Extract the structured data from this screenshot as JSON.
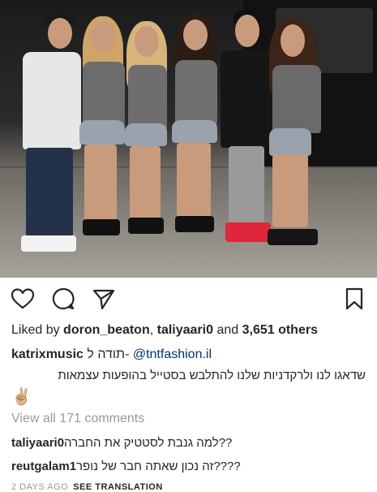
{
  "post": {
    "likes": {
      "prefix": "Liked by ",
      "user1": "doron_beaton",
      "separator": ", ",
      "user2": "taliyaari0",
      "middle": " and ",
      "count": "3,651 others"
    },
    "caption": {
      "username": "katrixmusic",
      "text": " תודה ל- ",
      "mention": "@tntfashion.il",
      "line2": "שדאגו לנו ולרקדניות שלנו להתלבש בסטייל בהופעות עצמאות",
      "emoji": "✌🏼"
    },
    "view_all_comments": "View all 171 comments",
    "comments": [
      {
        "username": "taliyaari0",
        "text": "למה גנבת לסטטיק את החברה??"
      },
      {
        "username": "reutgalam1",
        "text": "זה נכון שאתה חבר של נופר????"
      }
    ],
    "timestamp": "2 DAYS AGO",
    "see_translation": "SEE TRANSLATION"
  },
  "icons": {
    "like": "heart-icon",
    "comment": "comment-icon",
    "share": "share-icon",
    "save": "bookmark-icon"
  }
}
